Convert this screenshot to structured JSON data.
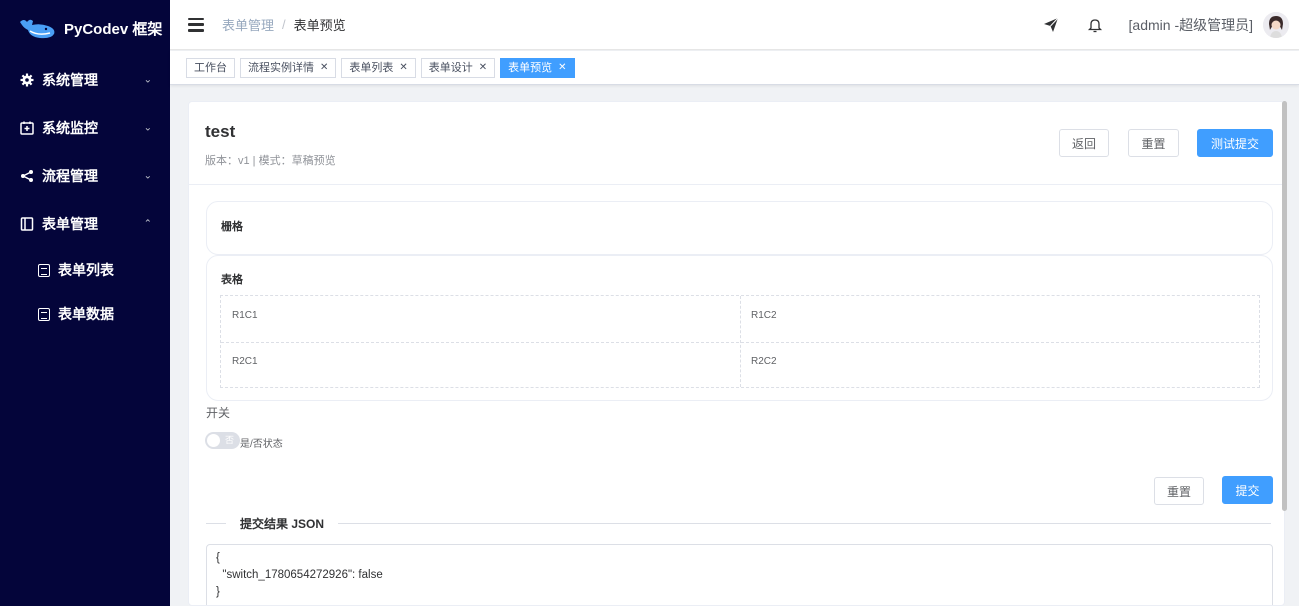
{
  "app": {
    "title": "PyCodev 框架"
  },
  "sidebar": {
    "items": [
      {
        "label": "系统管理",
        "icon": "gear-icon",
        "expanded": false
      },
      {
        "label": "系统监控",
        "icon": "monitor-icon",
        "expanded": false
      },
      {
        "label": "流程管理",
        "icon": "share-icon",
        "expanded": false
      },
      {
        "label": "表单管理",
        "icon": "form-icon",
        "expanded": true
      }
    ],
    "subitems": [
      {
        "label": "表单列表",
        "icon": "document-icon"
      },
      {
        "label": "表单数据",
        "icon": "document-icon"
      }
    ]
  },
  "header": {
    "breadcrumb": [
      "表单管理",
      "表单预览"
    ],
    "user": "[admin -超级管理员]"
  },
  "tags": [
    {
      "label": "工作台",
      "closable": false,
      "active": false
    },
    {
      "label": "流程实例详情",
      "closable": true,
      "active": false
    },
    {
      "label": "表单列表",
      "closable": true,
      "active": false
    },
    {
      "label": "表单设计",
      "closable": true,
      "active": false
    },
    {
      "label": "表单预览",
      "closable": true,
      "active": true
    }
  ],
  "form": {
    "title": "test",
    "meta": "版本：v1 | 模式：草稿预览",
    "buttons": {
      "back": "返回",
      "reset": "重置",
      "test_submit": "测试提交"
    },
    "grid_label": "栅格",
    "table_label": "表格",
    "table_cells": [
      [
        "R1C1",
        "R1C2"
      ],
      [
        "R2C1",
        "R2C2"
      ]
    ],
    "switch_label": "开关",
    "switch": {
      "inactive_text": "否",
      "hint": "是/否状态",
      "value": false
    },
    "bottom_buttons": {
      "reset": "重置",
      "submit": "提交"
    }
  },
  "result": {
    "label": "提交结果 JSON",
    "json": "{\n  \"switch_1780654272926\": false\n}"
  },
  "colors": {
    "sidebar_bg": "#04053a",
    "primary": "#409eff"
  }
}
